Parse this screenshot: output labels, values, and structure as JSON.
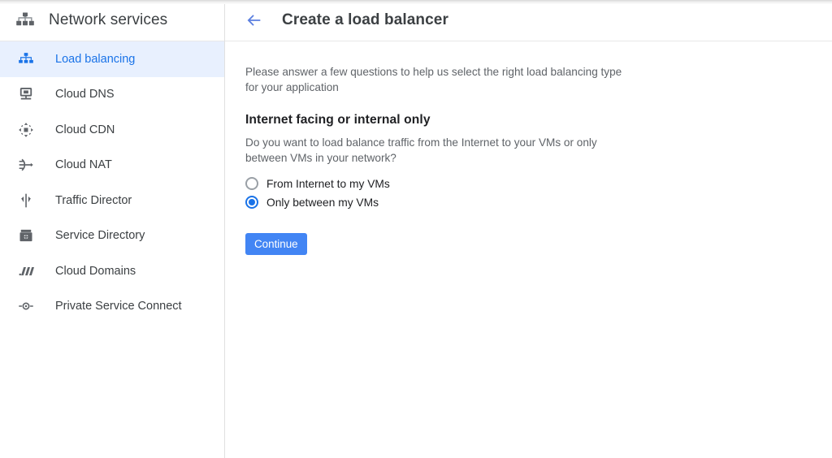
{
  "colors": {
    "accent": "#1a73e8",
    "button": "#4285f4",
    "active_bg": "#e8f0fe",
    "text_primary": "#202124",
    "text_secondary": "#5f6368",
    "border": "#e0e0e0"
  },
  "sidebar": {
    "logo_icon": "network-hierarchy-icon",
    "title": "Network services",
    "items": [
      {
        "label": "Load balancing",
        "icon": "load-balancing-icon",
        "active": true
      },
      {
        "label": "Cloud DNS",
        "icon": "cloud-dns-icon",
        "active": false
      },
      {
        "label": "Cloud CDN",
        "icon": "cloud-cdn-icon",
        "active": false
      },
      {
        "label": "Cloud NAT",
        "icon": "cloud-nat-icon",
        "active": false
      },
      {
        "label": "Traffic Director",
        "icon": "traffic-director-icon",
        "active": false
      },
      {
        "label": "Service Directory",
        "icon": "service-directory-icon",
        "active": false
      },
      {
        "label": "Cloud Domains",
        "icon": "cloud-domains-icon",
        "active": false
      },
      {
        "label": "Private Service Connect",
        "icon": "private-service-connect-icon",
        "active": false
      }
    ]
  },
  "header": {
    "back_icon": "back-arrow-icon",
    "title": "Create a load balancer"
  },
  "main": {
    "intro": "Please answer a few questions to help us select the right load balancing type for your application",
    "section_title": "Internet facing or internal only",
    "section_desc": "Do you want to load balance traffic from the Internet to your VMs or only between VMs in your network?",
    "radios": [
      {
        "label": "From Internet to my VMs",
        "checked": false
      },
      {
        "label": "Only between my VMs",
        "checked": true
      }
    ],
    "continue_label": "Continue"
  }
}
